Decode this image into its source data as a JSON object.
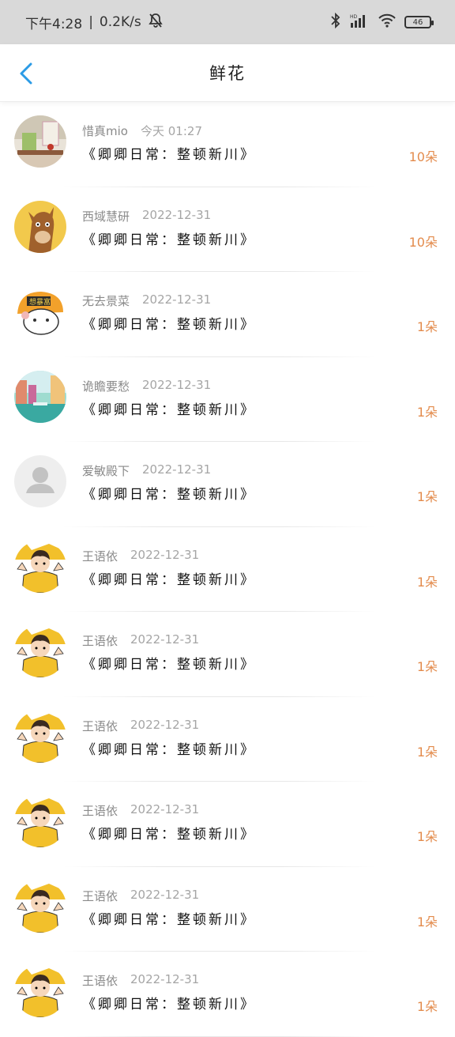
{
  "status_bar": {
    "time": "下午4:28",
    "speed": "0.2K/s",
    "battery": "46"
  },
  "header": {
    "title": "鲜花"
  },
  "colors": {
    "accent_blue": "#2b9be6",
    "count_orange": "#e38b4c"
  },
  "rows": [
    {
      "name": "惜真mio",
      "date": "今天 01:27",
      "book": "《卿卿日常：整顿新川》",
      "count": "10朵",
      "avatar": "cafe-photo"
    },
    {
      "name": "西域慧研",
      "date": "2022-12-31",
      "book": "《卿卿日常：整顿新川》",
      "count": "10朵",
      "avatar": "cartoon-horse"
    },
    {
      "name": "无去景菜",
      "date": "2022-12-31",
      "book": "《卿卿日常：整顿新川》",
      "count": "1朵",
      "avatar": "cartoon-cat-helmet"
    },
    {
      "name": "诡瞻要愁",
      "date": "2022-12-31",
      "book": "《卿卿日常：整顿新川》",
      "count": "1朵",
      "avatar": "canal-city"
    },
    {
      "name": "爱敏殿下",
      "date": "2022-12-31",
      "book": "《卿卿日常：整顿新川》",
      "count": "1朵",
      "avatar": "default-person"
    },
    {
      "name": "王语依",
      "date": "2022-12-31",
      "book": "《卿卿日常：整顿新川》",
      "count": "1朵",
      "avatar": "cartoon-boy-yellow"
    },
    {
      "name": "王语依",
      "date": "2022-12-31",
      "book": "《卿卿日常：整顿新川》",
      "count": "1朵",
      "avatar": "cartoon-boy-yellow"
    },
    {
      "name": "王语依",
      "date": "2022-12-31",
      "book": "《卿卿日常：整顿新川》",
      "count": "1朵",
      "avatar": "cartoon-boy-yellow"
    },
    {
      "name": "王语依",
      "date": "2022-12-31",
      "book": "《卿卿日常：整顿新川》",
      "count": "1朵",
      "avatar": "cartoon-boy-yellow"
    },
    {
      "name": "王语依",
      "date": "2022-12-31",
      "book": "《卿卿日常：整顿新川》",
      "count": "1朵",
      "avatar": "cartoon-boy-yellow"
    },
    {
      "name": "王语依",
      "date": "2022-12-31",
      "book": "《卿卿日常：整顿新川》",
      "count": "1朵",
      "avatar": "cartoon-boy-yellow"
    }
  ]
}
